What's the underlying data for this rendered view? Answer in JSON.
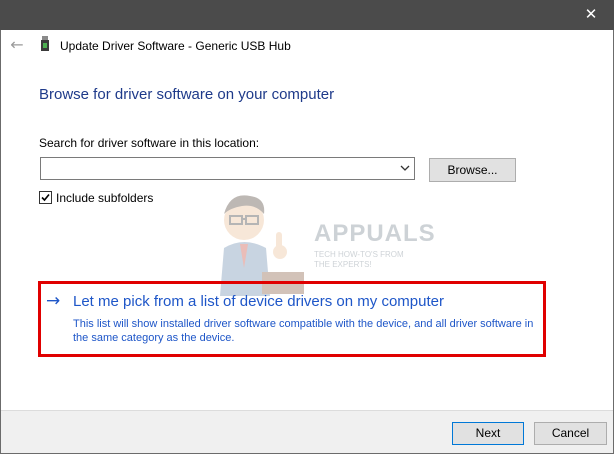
{
  "window": {
    "title": "Update Driver Software - Generic USB Hub",
    "close_glyph": "✕",
    "back_glyph": "←"
  },
  "main": {
    "heading": "Browse for driver software on your computer",
    "search_label": "Search for driver software in this location:",
    "search_value": "",
    "browse_label": "Browse...",
    "include_subfolders_label": "Include subfolders",
    "include_subfolders_checked": true
  },
  "watermark": {
    "brand": "APPUALS",
    "tagline_line1": "TECH HOW-TO'S FROM",
    "tagline_line2": "THE EXPERTS!"
  },
  "pick_option": {
    "arrow_glyph": "→",
    "title": "Let me pick from a list of device drivers on my computer",
    "description": "This list will show installed driver software compatible with the device, and all driver software in the same category as the device."
  },
  "footer": {
    "next_label": "Next",
    "cancel_label": "Cancel"
  },
  "colors": {
    "titlebar": "#4b4b4b",
    "heading_blue": "#1e3a8a",
    "link_blue": "#1e56c8",
    "highlight_red": "#e00000",
    "focus_blue": "#0078d7"
  }
}
